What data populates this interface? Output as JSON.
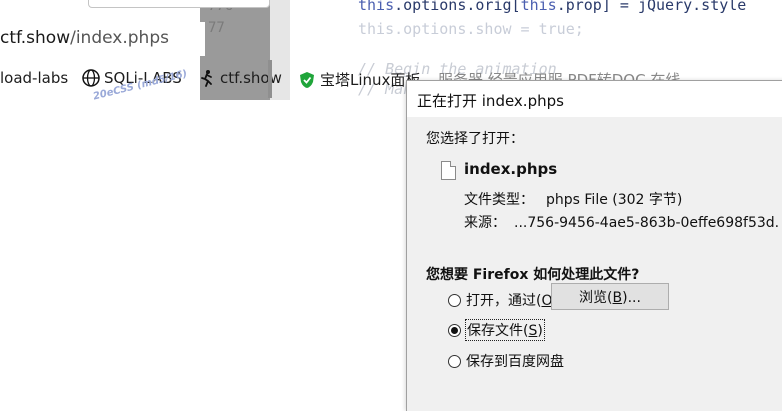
{
  "editor": {
    "gutter_numbers": [
      "776",
      "77"
    ],
    "line1_a": "this",
    "line1_b": ".options.orig[",
    "line1_c": "this",
    "line1_d": ".prop] = jQuery.style",
    "line2": "this.options.show = true;",
    "line3": "// Begin the animation",
    "line4": "// Make"
  },
  "browser": {
    "url_host": "ctf.show",
    "url_path": "/index.phps",
    "bookmarks": [
      {
        "label": "load-labs",
        "icon": "none"
      },
      {
        "label": "SQLi-LABS",
        "icon": "globe-icon"
      },
      {
        "label": "ctf.show",
        "icon": "runner-icon"
      },
      {
        "label": "宝塔Linux面板",
        "icon": "baota-shield-icon"
      },
      {
        "label": "服务器   经景应用服   PDF转DOC   在线",
        "icon": "none"
      }
    ],
    "watermark_text": "20eCSS (md5/16)"
  },
  "dialog": {
    "title": "正在打开 index.phps",
    "chosen_label": "您选择了打开：",
    "file_name": "index.phps",
    "type_label": "文件类型：",
    "type_value": "phps File (302 字节)",
    "source_label": "来源：",
    "source_value": "...756-9456-4ae5-863b-0effe698f53d.",
    "question": "您想要 Firefox 如何处理此文件?",
    "options": [
      {
        "label_pre": "打开，通过(",
        "accesskey": "O",
        "label_post": ")",
        "checked": false
      },
      {
        "label_pre": "保存文件(",
        "accesskey": "S",
        "label_post": ")",
        "checked": true
      },
      {
        "label_pre": "保存到百度网盘",
        "accesskey": "",
        "label_post": "",
        "checked": false
      }
    ],
    "browse_pre": "浏览(",
    "browse_key": "B",
    "browse_post": ")..."
  },
  "colors": {
    "dialog_bg": "#f0f0f0",
    "gutter": "#9a9a9a",
    "code_keyword": "#4b5fb0"
  }
}
